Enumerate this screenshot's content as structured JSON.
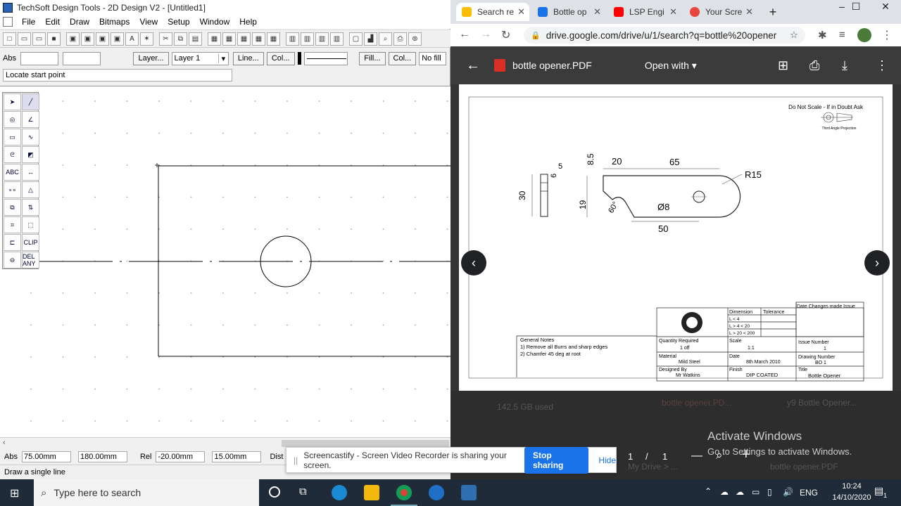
{
  "app": {
    "title": "TechSoft Design Tools - 2D Design V2 - [Untitled1]",
    "menu": [
      "File",
      "Edit",
      "Draw",
      "Bitmaps",
      "View",
      "Setup",
      "Window",
      "Help"
    ],
    "toolbar2": {
      "abs_label": "Abs",
      "layer_button": "Layer...",
      "layer_value": "Layer 1",
      "line_button": "Line...",
      "col_button": "Col...",
      "fill_button": "Fill...",
      "col2_button": "Col...",
      "fill_value": "No fill"
    },
    "prompt": "Locate start point",
    "tools": [
      "select-arrow",
      "line",
      "circle",
      "angle-line",
      "rectangle",
      "curve",
      "spiral",
      "hatch",
      "text ABC",
      "dimension",
      "points",
      "triangle",
      "copy",
      "mirror",
      "snap",
      "eraser",
      "polyline",
      "CLIP",
      "in/out",
      "DEL ANY"
    ],
    "tool_text": {
      "text": "ABC",
      "clip": "CLIP",
      "del": "DEL ANY"
    },
    "coords": {
      "abs_label": "Abs",
      "abs_x": "75.00mm",
      "abs_y": "180.00mm",
      "rel_label": "Rel",
      "rel_x": "-20.00mm",
      "rel_y": "15.00mm",
      "dist_label": "Dist"
    },
    "status": "Draw a single line"
  },
  "chrome": {
    "tabs": [
      {
        "label": "Search re",
        "active": true,
        "color": "#fbbc04"
      },
      {
        "label": "Bottle op",
        "active": false,
        "color": "#1a73e8"
      },
      {
        "label": "LSP Engi",
        "active": false,
        "color": "#ff0000"
      },
      {
        "label": "Your Scre",
        "active": false,
        "color": "#e8453c"
      }
    ],
    "url": "drive.google.com/drive/u/1/search?q=bottle%20opener",
    "pdf_title": "bottle opener.PDF",
    "open_with": "Open with",
    "page_num": "1",
    "page_sep": "/",
    "page_total": "1"
  },
  "drawing": {
    "header": "Do Not Scale - If in Doubt Ask",
    "projection": "Third Angle Projection",
    "dims": [
      "5",
      "6",
      "30",
      "8.5",
      "20",
      "65",
      "R15",
      "19",
      "60°",
      "Ø8",
      "50"
    ],
    "table": {
      "date_changes": "Date Changes made Issue",
      "dimension": "Dimension",
      "tolerance": "Tolerance",
      "tol_rows": [
        "L < 4",
        "L > 4 < 20",
        "L > 20 < 200"
      ],
      "general_notes": "General Notes",
      "notes": [
        "1) Remove all Burrs and sharp edges",
        "2) Chamfer 45 deg at root"
      ],
      "qty_label": "Quantity Required",
      "qty": "1 off",
      "scale_label": "Scale",
      "scale": "1:1",
      "issue_label": "Issue Number",
      "issue": "1",
      "material_label": "Material",
      "material": "Mild Steel",
      "date_label": "Date",
      "date": "8th March 2010",
      "drawing_no_label": "Drawing Number",
      "drawing_no": "BO 1",
      "designed_label": "Designed By",
      "designed": "Mr Watkins",
      "finish_label": "Finish",
      "finish": "DIP COATED",
      "title_label": "Title",
      "title": "Bottle Opener"
    }
  },
  "background_drive": {
    "storage": "142.5 GB used",
    "file1": "bottle opener.PD...",
    "file2": "y9 Bottle Opener...",
    "breadcrumb": "My Drive > ...",
    "file3": "bottle opener.PDF"
  },
  "screencastify": {
    "message": "Screencastify - Screen Video Recorder is sharing your screen.",
    "stop": "Stop sharing",
    "hide": "Hide"
  },
  "activate": {
    "title": "Activate Windows",
    "sub": "Go to Settings to activate Windows."
  },
  "taskbar": {
    "search_placeholder": "Type here to search",
    "lang": "ENG",
    "time": "10:24",
    "date": "14/10/2020",
    "notif": "1"
  }
}
